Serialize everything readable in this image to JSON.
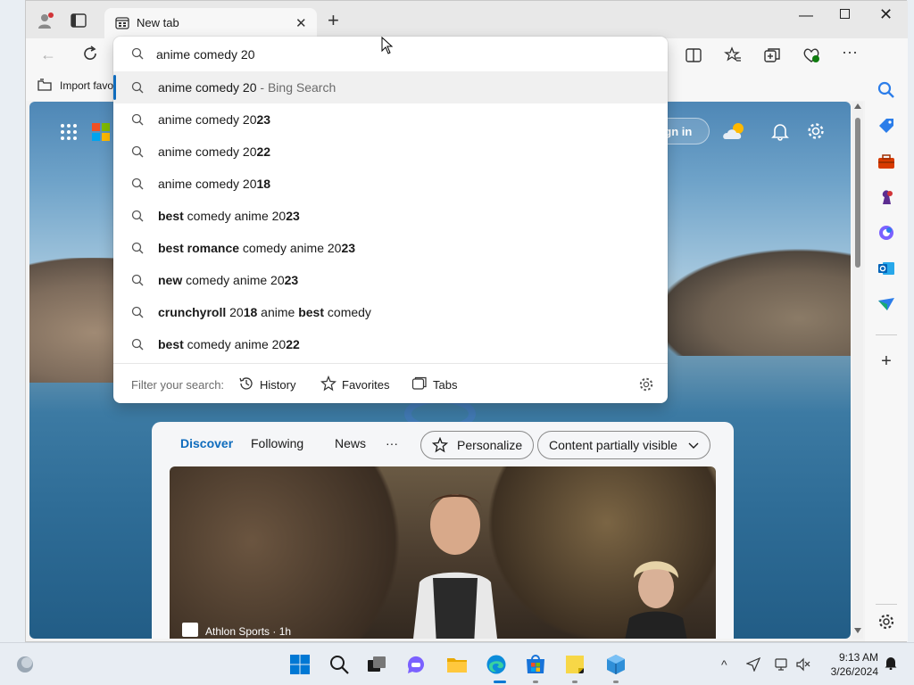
{
  "browser": {
    "tab_title": "New tab",
    "favorites_bar": {
      "import_label": "Import favo"
    }
  },
  "omnibox": {
    "query": "anime comedy 20",
    "suggestions": [
      {
        "parts": [
          {
            "t": "anime comedy 20",
            "b": false
          },
          {
            "t": " - Bing Search",
            "b": false,
            "muted": true
          }
        ],
        "selected": true
      },
      {
        "parts": [
          {
            "t": "anime comedy 20",
            "b": false
          },
          {
            "t": "23",
            "b": true
          }
        ]
      },
      {
        "parts": [
          {
            "t": "anime comedy 20",
            "b": false
          },
          {
            "t": "22",
            "b": true
          }
        ]
      },
      {
        "parts": [
          {
            "t": "anime comedy 20",
            "b": false
          },
          {
            "t": "18",
            "b": true
          }
        ]
      },
      {
        "parts": [
          {
            "t": "best",
            "b": true
          },
          {
            "t": " comedy anime 20",
            "b": false
          },
          {
            "t": "23",
            "b": true
          }
        ]
      },
      {
        "parts": [
          {
            "t": "best romance",
            "b": true
          },
          {
            "t": " comedy anime 20",
            "b": false
          },
          {
            "t": "23",
            "b": true
          }
        ]
      },
      {
        "parts": [
          {
            "t": "new",
            "b": true
          },
          {
            "t": " comedy anime 20",
            "b": false
          },
          {
            "t": "23",
            "b": true
          }
        ]
      },
      {
        "parts": [
          {
            "t": "crunchyroll",
            "b": true
          },
          {
            "t": " 20",
            "b": false
          },
          {
            "t": "18",
            "b": true
          },
          {
            "t": " anime ",
            "b": false
          },
          {
            "t": "best",
            "b": true
          },
          {
            "t": " comedy",
            "b": false
          }
        ]
      },
      {
        "parts": [
          {
            "t": "best",
            "b": true
          },
          {
            "t": " comedy anime 20",
            "b": false
          },
          {
            "t": "22",
            "b": true
          }
        ]
      }
    ],
    "footer": {
      "filter_label": "Filter your search:",
      "history": "History",
      "favorites": "Favorites",
      "tabs": "Tabs"
    }
  },
  "new_tab_page": {
    "sign_in": "Sign in",
    "feed": {
      "tabs": [
        "Discover",
        "Following",
        "News"
      ],
      "more": "···",
      "personalize": "Personalize",
      "content_visibility": "Content partially visible",
      "story_source": "Athlon Sports · 1h"
    }
  },
  "taskbar": {
    "time": "9:13 AM",
    "date": "3/26/2024"
  },
  "colors": {
    "accent": "#0f6cbd",
    "omnibox_selected": "#f0f0f0",
    "muted_text": "#6b6b6b"
  }
}
